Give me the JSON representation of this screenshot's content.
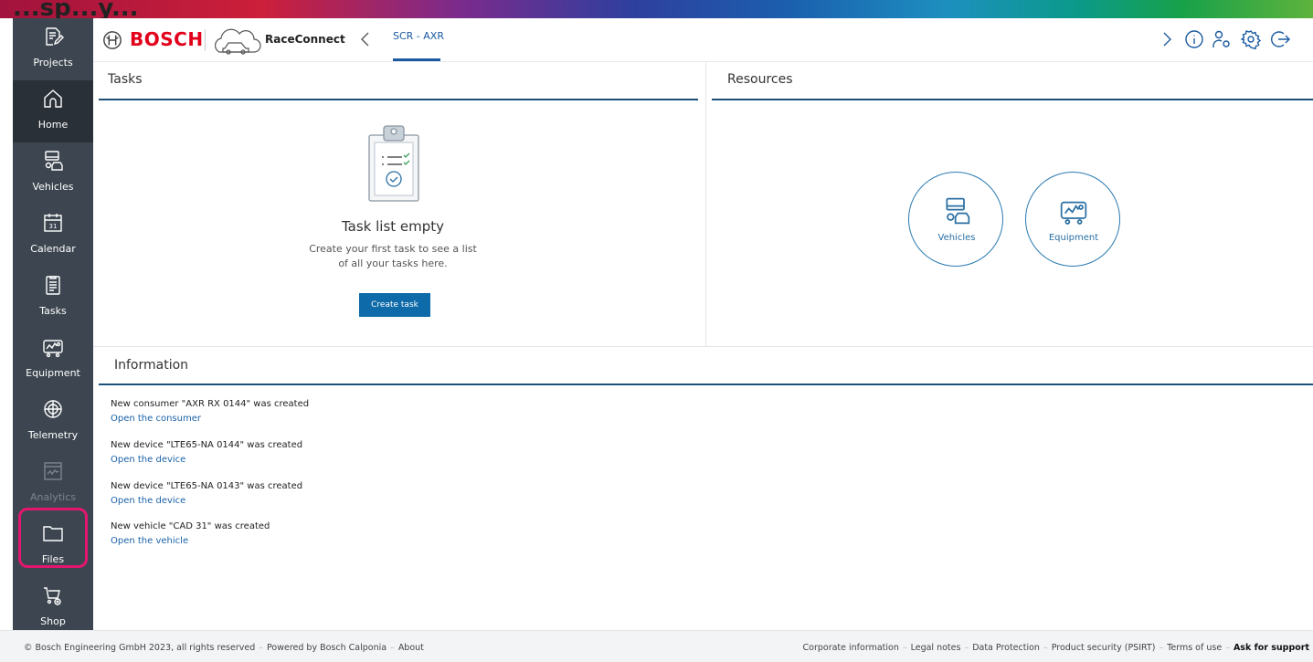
{
  "strip": {
    "partial_text": "...sp...y..."
  },
  "sidebar": {
    "items": [
      {
        "label": "Projects",
        "icon": "edit-document-icon"
      },
      {
        "label": "Home",
        "icon": "home-icon",
        "active": true
      },
      {
        "label": "Vehicles",
        "icon": "vehicles-icon"
      },
      {
        "label": "Calendar",
        "icon": "calendar-icon",
        "badge": "31"
      },
      {
        "label": "Tasks",
        "icon": "tasks-icon"
      },
      {
        "label": "Equipment",
        "icon": "equipment-icon"
      },
      {
        "label": "Telemetry",
        "icon": "telemetry-icon"
      },
      {
        "label": "Analytics",
        "icon": "analytics-icon",
        "disabled": true
      },
      {
        "label": "Files",
        "icon": "folder-icon",
        "highlighted": true
      },
      {
        "label": "Shop",
        "icon": "shop-cart-icon"
      }
    ]
  },
  "header": {
    "brand": "BOSCH",
    "product": "RaceConnect",
    "active_tab": "SCR - AXR"
  },
  "tasks": {
    "title": "Tasks",
    "empty_title": "Task list empty",
    "empty_line1": "Create your first task to see a list",
    "empty_line2": "of all your tasks here.",
    "button": "Create task"
  },
  "resources": {
    "title": "Resources",
    "vehicles": "Vehicles",
    "equipment": "Equipment"
  },
  "information": {
    "title": "Information",
    "entries": [
      {
        "message": "New consumer \"AXR RX 0144\" was created",
        "link": "Open the consumer"
      },
      {
        "message": "New device \"LTE65-NA 0144\" was created",
        "link": "Open the device"
      },
      {
        "message": "New device \"LTE65-NA 0143\" was created",
        "link": "Open the device"
      },
      {
        "message": "New vehicle \"CAD 31\" was created",
        "link": "Open the vehicle"
      }
    ]
  },
  "footer": {
    "copyright": "© Bosch Engineering GmbH 2023, all rights reserved",
    "powered": "Powered by Bosch Calponia",
    "about": "About",
    "corporate": "Corporate information",
    "legal": "Legal notes",
    "privacy": "Data Protection",
    "security": "Product security (PSIRT)",
    "terms": "Terms of use",
    "support": "Ask for support"
  },
  "colors": {
    "sidebar_bg": "#3d4650",
    "sidebar_active": "#2a3038",
    "accent_blue": "#0e6aa8",
    "bosch_red": "#e2001a",
    "highlight_pink": "#e3166f"
  }
}
